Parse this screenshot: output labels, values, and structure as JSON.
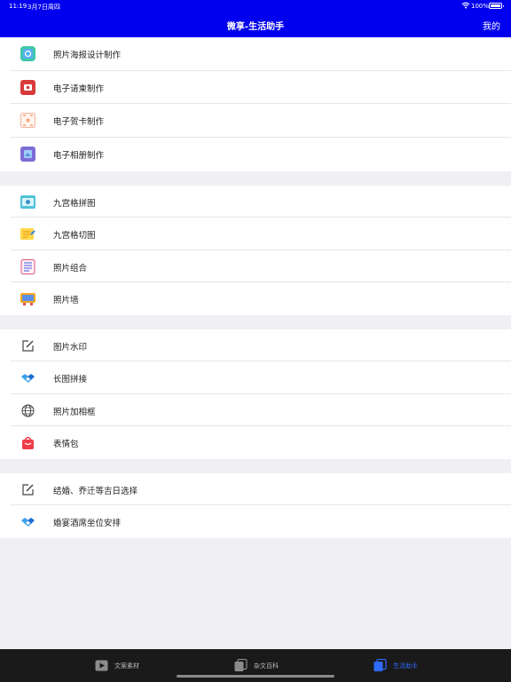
{
  "status_bar": {
    "time": "11:19",
    "date": "3月7日周四",
    "battery": "100%"
  },
  "nav": {
    "title": "微享-生活助手",
    "right": "我的"
  },
  "groups": [
    {
      "items": [
        {
          "label": "照片海报设计制作",
          "icon": "poster-icon"
        },
        {
          "label": "电子请柬制作",
          "icon": "invitation-icon"
        },
        {
          "label": "电子贺卡制作",
          "icon": "greeting-card-icon"
        },
        {
          "label": "电子相册制作",
          "icon": "photo-album-icon"
        }
      ]
    },
    {
      "items": [
        {
          "label": "九宫格拼图",
          "icon": "grid-collage-icon"
        },
        {
          "label": "九宫格切图",
          "icon": "grid-cut-icon"
        },
        {
          "label": "照片组合",
          "icon": "photo-combine-icon"
        },
        {
          "label": "照片墙",
          "icon": "photo-wall-icon"
        }
      ]
    },
    {
      "items": [
        {
          "label": "图片水印",
          "icon": "edit-icon"
        },
        {
          "label": "长图拼接",
          "icon": "handshake-icon"
        },
        {
          "label": "照片加相框",
          "icon": "globe-icon"
        },
        {
          "label": "表情包",
          "icon": "shopping-bag-icon"
        }
      ]
    },
    {
      "items": [
        {
          "label": "结婚、乔迁等吉日选择",
          "icon": "edit-icon"
        },
        {
          "label": "婚宴酒席坐位安排",
          "icon": "handshake-icon"
        }
      ]
    }
  ],
  "tabs": [
    {
      "label": "文案素材",
      "icon": "play-icon",
      "active": false
    },
    {
      "label": "杂文百科",
      "icon": "copy-icon",
      "active": false
    },
    {
      "label": "生活助手",
      "icon": "copy-icon",
      "active": true
    }
  ],
  "colors": {
    "nav": "#0000ee",
    "tab_active": "#2f6bff",
    "tab_bar": "#1a1a1a"
  }
}
